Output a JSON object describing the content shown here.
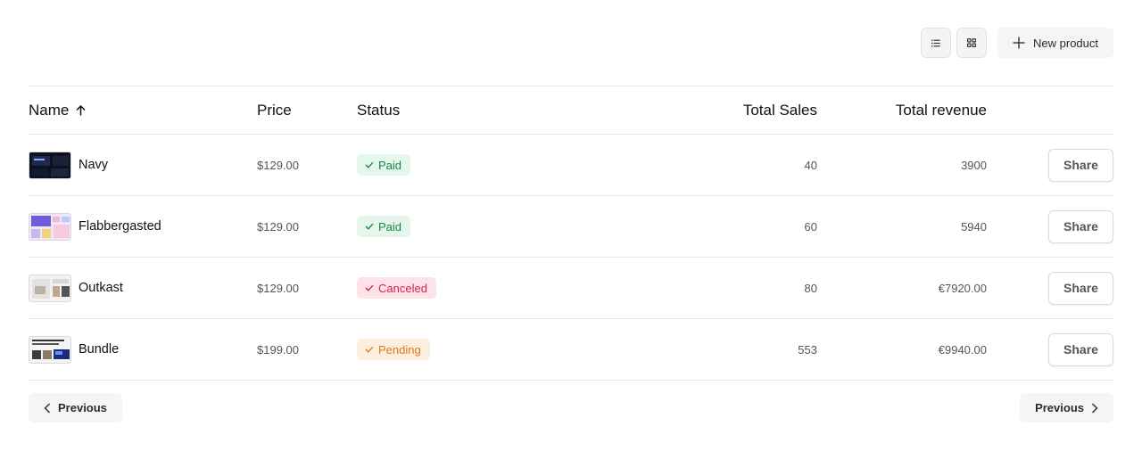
{
  "toolbar": {
    "list_view_icon": "list-icon",
    "grid_view_icon": "grid-icon",
    "new_product_label": "New product"
  },
  "table": {
    "headers": {
      "name": "Name",
      "price": "Price",
      "status": "Status",
      "total_sales": "Total Sales",
      "total_revenue": "Total revenue"
    },
    "sort_icon": "arrow-up-icon",
    "rows": [
      {
        "name": "Navy",
        "price": "$129.00",
        "status": "Paid",
        "status_kind": "paid",
        "total_sales": "40",
        "total_revenue": "3900",
        "action": "Share"
      },
      {
        "name": "Flabbergasted",
        "price": "$129.00",
        "status": "Paid",
        "status_kind": "paid",
        "total_sales": "60",
        "total_revenue": "5940",
        "action": "Share"
      },
      {
        "name": "Outkast",
        "price": "$129.00",
        "status": "Canceled",
        "status_kind": "canceled",
        "total_sales": "80",
        "total_revenue": "€7920.00",
        "action": "Share"
      },
      {
        "name": "Bundle",
        "price": "$199.00",
        "status": "Pending",
        "status_kind": "pending",
        "total_sales": "553",
        "total_revenue": "€9940.00",
        "action": "Share"
      }
    ]
  },
  "pagination": {
    "prev_label": "Previous",
    "next_label": "Previous"
  },
  "colors": {
    "paid": "#138a45",
    "canceled": "#d1234e",
    "pending": "#de7b10"
  }
}
